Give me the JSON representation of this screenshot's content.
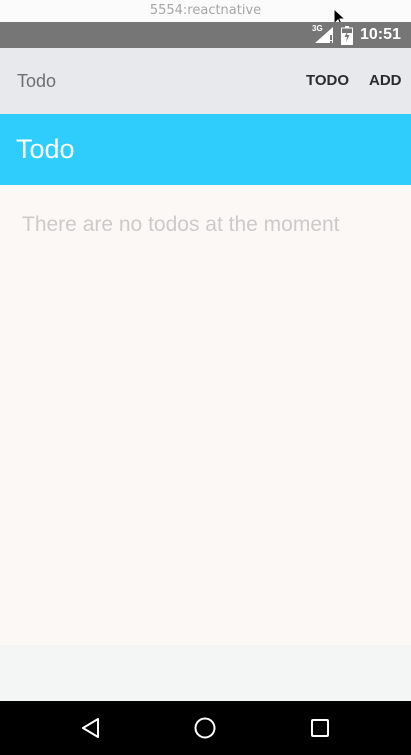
{
  "window": {
    "title": "5554:reactnative"
  },
  "status_bar": {
    "network_label": "3G",
    "time": "10:51",
    "icons": [
      "signal-icon",
      "battery-icon"
    ],
    "background": "#767676"
  },
  "toolbar": {
    "title": "Todo",
    "actions": [
      {
        "label": "TODO"
      },
      {
        "label": "ADD"
      }
    ],
    "background": "#e8e9ed"
  },
  "header": {
    "title": "Todo",
    "background": "#2fcdfb"
  },
  "content": {
    "empty_message": "There are no todos at the moment",
    "background": "#fcf8f5"
  },
  "nav_bar": {
    "buttons": [
      "back-icon",
      "home-icon",
      "recents-icon"
    ],
    "background": "#000000"
  }
}
